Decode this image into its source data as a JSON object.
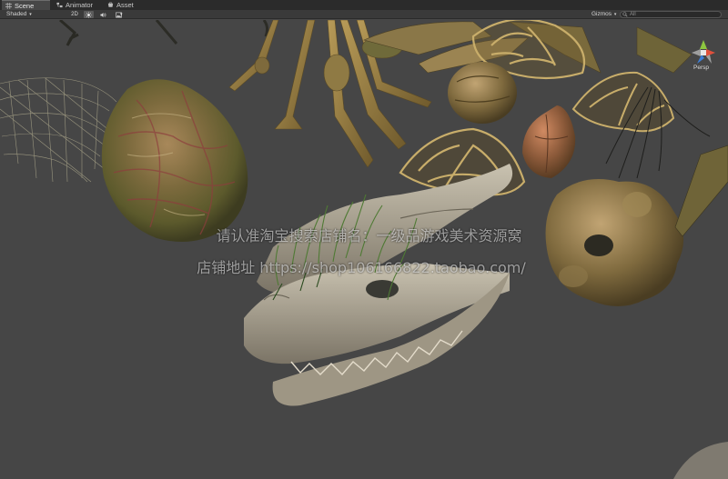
{
  "tabs": [
    {
      "label": "Scene",
      "active": true,
      "icon": "scene-grid-icon"
    },
    {
      "label": "Animator",
      "active": false,
      "icon": "animator-icon"
    },
    {
      "label": "Asset Store",
      "active": false,
      "icon": "asset-store-icon"
    }
  ],
  "toolbar": {
    "shading_mode": "Shaded",
    "mode_2d": "2D",
    "lighting_icon": "sun-icon",
    "audio_icon": "speaker-icon",
    "effects_icon": "image-icon",
    "gizmos_label": "Gizmos",
    "search_placeholder": "All"
  },
  "scene": {
    "projection_label": "Persp",
    "background_color": "#464646"
  },
  "watermark": {
    "line1": "请认准淘宝搜索店铺名：一级品游戏美术资源窝",
    "line2": "店铺地址 https://shop106166822.taobao.com/"
  }
}
